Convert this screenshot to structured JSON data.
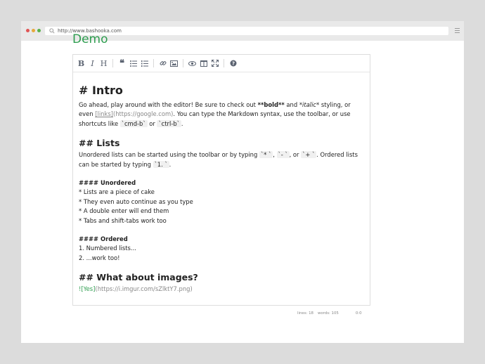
{
  "browser": {
    "url": "http://www.bashooka.com",
    "traffic_lights": [
      "#e05454",
      "#e7a93b",
      "#5ab14b"
    ]
  },
  "page": {
    "title": "Demo"
  },
  "toolbar": {
    "buttons": [
      "bold-icon",
      "italic-icon",
      "heading-icon",
      "quote-icon",
      "unordered-list-icon",
      "ordered-list-icon",
      "link-icon",
      "image-icon",
      "preview-icon",
      "side-by-side-icon",
      "fullscreen-icon",
      "help-icon"
    ]
  },
  "content": {
    "h_intro": "# Intro",
    "intro_a": "Go ahead, play around with the editor! Be sure to check out ",
    "intro_bold": "**bold**",
    "intro_b": " and ",
    "intro_italic": "*italic*",
    "intro_c": " styling, or even ",
    "intro_link_text": "[links]",
    "intro_link_url": "(https://google.com)",
    "intro_d": ". You can type the Markdown syntax, use the toolbar, or use shortcuts like ",
    "intro_code1": "`cmd-b`",
    "intro_e": " or ",
    "intro_code2": "`ctrl-b`",
    "intro_f": ".",
    "h_lists": "## Lists",
    "lists_a": "Unordered lists can be started using the toolbar or by typing ",
    "lists_code1": "`* `",
    "lists_b": ", ",
    "lists_code2": "`- `",
    "lists_c": ", or ",
    "lists_code3": "`+ `",
    "lists_d": ". Ordered lists can be started by typing ",
    "lists_code4": "`1. `",
    "lists_e": ".",
    "h_unordered": "#### Unordered",
    "unordered_items": [
      "* Lists are a piece of cake",
      "* They even auto continue as you type",
      "* A double enter will end them",
      "* Tabs and shift-tabs work too"
    ],
    "h_ordered": "#### Ordered",
    "ordered_items": [
      "1. Numbered lists...",
      "2. ...work too!"
    ],
    "h_images": "## What about images?",
    "image_alt": "![Yes]",
    "image_url": "(https://i.imgur.com/sZlktY7.png)"
  },
  "status": {
    "lines": "lines: 18",
    "words": "words: 105",
    "cursor": "0:0"
  }
}
